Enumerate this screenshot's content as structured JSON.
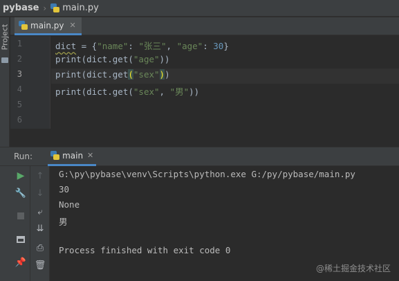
{
  "breadcrumb": {
    "project": "pybase",
    "file": "main.py"
  },
  "project_strip": {
    "label": "Project"
  },
  "editor_tab": {
    "label": "main.py"
  },
  "editor": {
    "line_numbers": [
      "1",
      "2",
      "3",
      "4",
      "5",
      "6"
    ],
    "current_line": 3,
    "lines": [
      {
        "code_a": "dict",
        "code_b": " = {",
        "s1": "\"name\"",
        "c1": ": ",
        "s2": "\"张三\"",
        "c2": ", ",
        "s3": "\"age\"",
        "c3": ": ",
        "n1": "30",
        "c4": "}"
      },
      {
        "p1": "print(dict.get(",
        "s1": "\"age\"",
        "p2": "))"
      },
      {
        "p1": "print(dict.get",
        "br1": "(",
        "s1": "\"sex\"",
        "br2": ")",
        "p2": ")"
      },
      {
        "p1": "print(dict.get(",
        "s1": "\"sex\"",
        "c1": ", ",
        "s2": "\"男\"",
        "p2": "))"
      }
    ]
  },
  "run_panel": {
    "title": "Run:",
    "tab_label": "main",
    "output": [
      "G:\\py\\pybase\\venv\\Scripts\\python.exe G:/py/pybase/main.py",
      "30",
      "None",
      "男",
      "",
      "Process finished with exit code 0"
    ]
  },
  "watermark": "@稀土掘金技术社区",
  "colors": {
    "background": "#2b2b2b",
    "panel": "#3c3f41",
    "string": "#6a8759",
    "number": "#6897bb",
    "accent": "#4a88c7"
  }
}
